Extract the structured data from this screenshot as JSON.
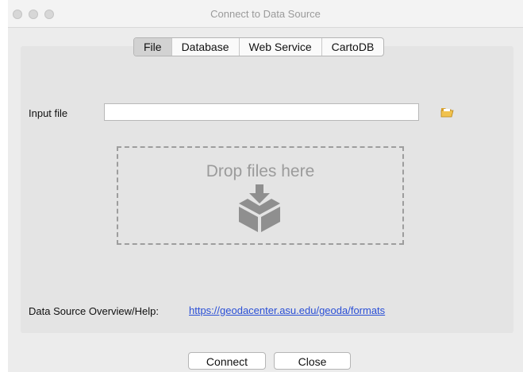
{
  "window": {
    "title": "Connect to Data Source"
  },
  "tabs": [
    {
      "label": "File",
      "active": true
    },
    {
      "label": "Database",
      "active": false
    },
    {
      "label": "Web Service",
      "active": false
    },
    {
      "label": "CartoDB",
      "active": false
    }
  ],
  "file_tab": {
    "input_label": "Input file",
    "input_value": "",
    "drop_text": "Drop files here"
  },
  "help": {
    "label": "Data Source Overview/Help:",
    "link": "https://geodacenter.asu.edu/geoda/formats"
  },
  "buttons": {
    "connect": "Connect",
    "close": "Close"
  },
  "colors": {
    "link": "#2a4fd6",
    "active_tab": "#d2d2d2",
    "folder_icon": "#e8b43a"
  },
  "icons": [
    "open-folder-icon",
    "download-box-icon"
  ]
}
